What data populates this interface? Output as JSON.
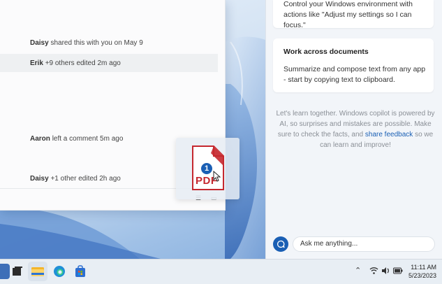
{
  "document": {
    "activity": [
      {
        "name": "Daisy",
        "text": "shared this with you on May 9"
      },
      {
        "name": "Erik",
        "text": "+9 others edited 2m ago"
      },
      {
        "name": "Aaron",
        "text": "left a comment 5m ago"
      },
      {
        "name": "Daisy",
        "text": "+1 other edited 2h ago"
      }
    ]
  },
  "drag_file": {
    "badge": "1",
    "type": "PDF"
  },
  "copilot": {
    "cards": [
      {
        "title": "",
        "body": "Control your Windows environment with actions like \"Adjust my settings so I can focus.\""
      },
      {
        "title": "Work across documents",
        "body": "Summarize and compose text from any app - start by copying text to clipboard."
      }
    ],
    "disclaimer_text": "Let's learn together. Windows copilot is powered by AI, so surprises and mistakes are possible. Make sure to check the facts, and",
    "feedback_link": "share feedback",
    "disclaimer_tail": "so we can learn and improve!",
    "input_placeholder": "Ask me anything..."
  },
  "taskbar": {
    "time": "11:11 AM",
    "date": "5/23/2023"
  },
  "colors": {
    "accent": "#1a5fb4",
    "pdf_red": "#c5282f"
  }
}
